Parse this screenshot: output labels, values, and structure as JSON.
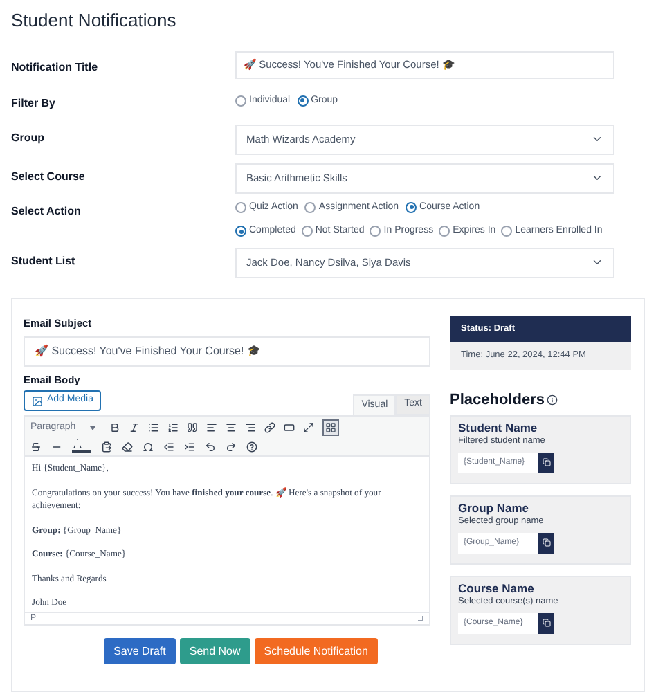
{
  "title": "Student Notifications",
  "form": {
    "notification_title": {
      "label": "Notification Title",
      "value": "🚀 Success! You've Finished Your Course! 🎓"
    },
    "filter_by": {
      "label": "Filter By",
      "options": [
        {
          "label": "Individual",
          "selected": false
        },
        {
          "label": "Group",
          "selected": true
        }
      ]
    },
    "group": {
      "label": "Group",
      "value": "Math Wizards Academy"
    },
    "select_course": {
      "label": "Select Course",
      "value": "Basic Arithmetic Skills"
    },
    "select_action": {
      "label": "Select Action",
      "actions": [
        {
          "label": "Quiz Action",
          "selected": false
        },
        {
          "label": "Assignment Action",
          "selected": false
        },
        {
          "label": "Course Action",
          "selected": true
        }
      ],
      "statuses": [
        {
          "label": "Completed",
          "selected": true
        },
        {
          "label": "Not Started",
          "selected": false
        },
        {
          "label": "In Progress",
          "selected": false
        },
        {
          "label": "Expires In",
          "selected": false
        },
        {
          "label": "Learners Enrolled In",
          "selected": false
        }
      ]
    },
    "student_list": {
      "label": "Student List",
      "value": "Jack Doe, Nancy Dsilva, Siya Davis"
    }
  },
  "email": {
    "subject_label": "Email Subject",
    "subject": "🚀 Success! You've Finished Your Course! 🎓",
    "body_label": "Email Body",
    "add_media": "Add Media",
    "tabs": [
      {
        "label": "Visual",
        "selected": true
      },
      {
        "label": "Text",
        "selected": false
      }
    ],
    "format": "Paragraph",
    "toolbar_toggle_on": true,
    "body": [
      "Hi {Student_Name},",
      "Congratulations on your success! You have **finished your course**. 🚀 Here's a snapshot of your achievement:",
      "**Group:** {Group_Name}",
      "**Course:** {Course_Name}",
      "Thanks and Regards",
      "John Doe"
    ],
    "path": "P"
  },
  "buttons": [
    {
      "label": "Save Draft",
      "kind": "save"
    },
    {
      "label": "Send Now",
      "kind": "send"
    },
    {
      "label": "Schedule Notification",
      "kind": "schedule"
    }
  ],
  "status": {
    "title": "Status: Draft",
    "time": "Time: June 22, 2024, 12:44 PM"
  },
  "placeholders": {
    "title": "Placeholders",
    "items": [
      {
        "name": "Student Name",
        "description": "Filtered student name",
        "token": "{Student_Name}"
      },
      {
        "name": "Group Name",
        "description": "Selected group name",
        "token": "{Group_Name}"
      },
      {
        "name": "Course Name",
        "description": "Selected course(s) name",
        "token": "{Course_Name}"
      }
    ]
  }
}
